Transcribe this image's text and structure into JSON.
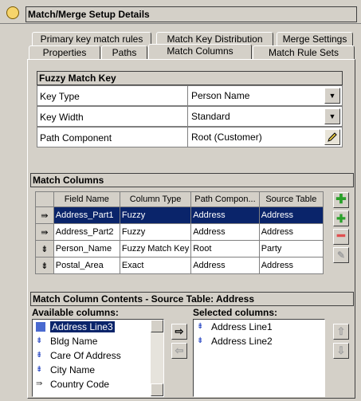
{
  "window": {
    "title": "Match/Merge Setup Details"
  },
  "tabs_row1": [
    "Primary key match rules",
    "Match Key Distribution",
    "Merge Settings"
  ],
  "tabs_row2": [
    "Properties",
    "Paths",
    "Match Columns",
    "Match Rule Sets"
  ],
  "active_tab": "Match Columns",
  "fuzzy_match_key": {
    "title": "Fuzzy Match Key",
    "rows": [
      {
        "label": "Key Type",
        "value": "Person Name"
      },
      {
        "label": "Key Width",
        "value": "Standard"
      },
      {
        "label": "Path Component",
        "value": "Root (Customer)"
      }
    ]
  },
  "match_columns": {
    "title": "Match Columns",
    "headers": [
      "Field Name",
      "Column Type",
      "Path Compon...",
      "Source Table"
    ],
    "rows": [
      {
        "field": "Address_Part1",
        "type": "Fuzzy",
        "path": "Address",
        "source": "Address",
        "selected": true
      },
      {
        "field": "Address_Part2",
        "type": "Fuzzy",
        "path": "Address",
        "source": "Address",
        "selected": false
      },
      {
        "field": "Person_Name",
        "type": "Fuzzy Match Key",
        "path": "Root",
        "source": "Party",
        "selected": false
      },
      {
        "field": "Postal_Area",
        "type": "Exact",
        "path": "Address",
        "source": "Address",
        "selected": false
      }
    ]
  },
  "contents": {
    "title": "Match Column Contents - Source Table: Address",
    "available_label": "Available columns:",
    "selected_label": "Selected columns:",
    "available": [
      "Address Line3",
      "Bldg Name",
      "Care Of Address",
      "City Name",
      "Country Code"
    ],
    "selected": [
      "Address Line1",
      "Address Line2"
    ]
  },
  "colors": {
    "selection": "#0a246a",
    "add": "#2aa02a",
    "remove": "#e05050"
  }
}
